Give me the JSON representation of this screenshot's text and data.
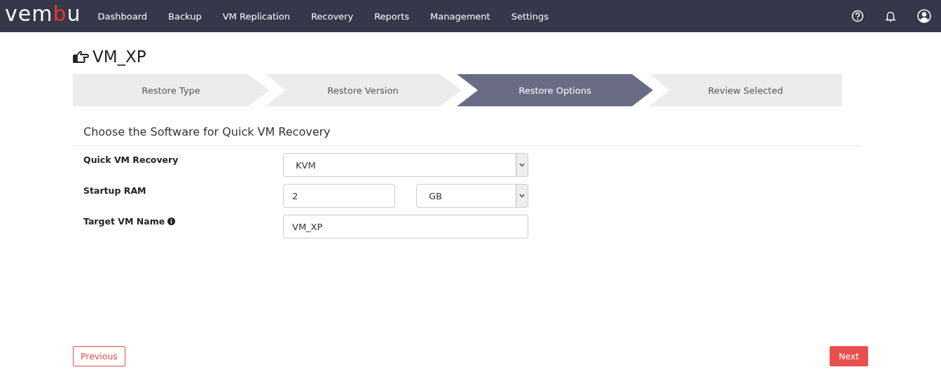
{
  "logo": {
    "before": "vem",
    "accent": "b",
    "after": "u"
  },
  "nav": [
    {
      "label": "Dashboard"
    },
    {
      "label": "Backup"
    },
    {
      "label": "VM Replication"
    },
    {
      "label": "Recovery"
    },
    {
      "label": "Reports"
    },
    {
      "label": "Management"
    },
    {
      "label": "Settings"
    }
  ],
  "page_title": "VM_XP",
  "steps": [
    {
      "label": "Restore Type",
      "selected": false
    },
    {
      "label": "Restore Version",
      "selected": false
    },
    {
      "label": "Restore Options",
      "selected": true
    },
    {
      "label": "Review Selected",
      "selected": false
    }
  ],
  "section_title": "Choose the Software for Quick VM Recovery",
  "form": [
    {
      "kind": "plain",
      "label": "Quick VM Recovery",
      "fields": [
        {
          "kind": "select",
          "value": "KVM"
        }
      ]
    },
    {
      "kind": "plain",
      "label": "Startup RAM",
      "fields": [
        {
          "kind": "input",
          "value": "2"
        },
        {
          "kind": "select",
          "value": "GB"
        }
      ]
    },
    {
      "kind": "with_info",
      "label": "Target VM Name",
      "fields": [
        {
          "kind": "input",
          "value": "VM_XP"
        }
      ]
    }
  ],
  "buttons": {
    "previous": "Previous",
    "next": "Next"
  }
}
